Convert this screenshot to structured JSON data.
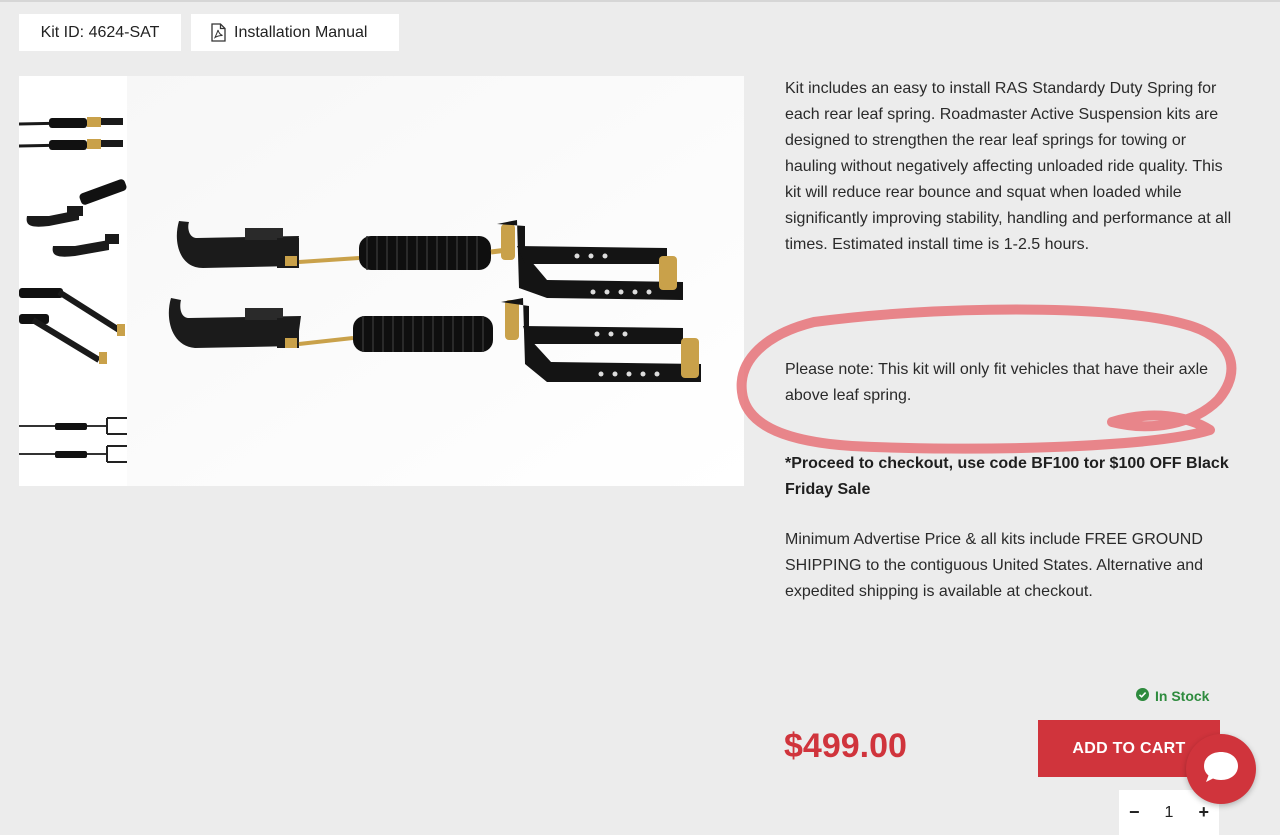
{
  "header": {
    "kit_id": "Kit ID: 4624-SAT",
    "manual_label": "Installation Manual",
    "manual_icon": "pdf-file-icon"
  },
  "gallery": {
    "thumbnails": [
      "thumbnail-1",
      "thumbnail-2",
      "thumbnail-3",
      "thumbnail-4"
    ],
    "main_image": "product-photo"
  },
  "description": {
    "p1": " Kit includes an easy to install RAS Standardy Duty Spring for each rear leaf spring. Roadmaster Active Suspension kits are designed to strengthen the rear leaf springs for towing or hauling without negatively affecting unloaded ride quality. This kit will reduce rear bounce and squat when loaded while significantly improving stability, handling and performance at all times. Estimated install time is 1-2.5 hours.",
    "note": "Please note: This kit will only fit vehicles that have their axle above leaf spring.",
    "promo": "*Proceed to checkout, use code BF100 tor $100 OFF Black Friday Sale",
    "shipping": "Minimum Advertise Price & all kits include FREE GROUND SHIPPING to the contiguous United States. Alternative and expedited shipping is available at checkout."
  },
  "purchase": {
    "stock_status": "In Stock",
    "price": "$499.00",
    "add_to_cart": "ADD TO CART",
    "qty_minus": "−",
    "qty_value": "1",
    "qty_plus": "+"
  },
  "colors": {
    "accent": "#d0343c",
    "stock_green": "#2e8b3e",
    "background": "#ececec",
    "annotation": "#e87a80"
  },
  "annotation": {
    "type": "hand-drawn-circle",
    "target": "note"
  }
}
